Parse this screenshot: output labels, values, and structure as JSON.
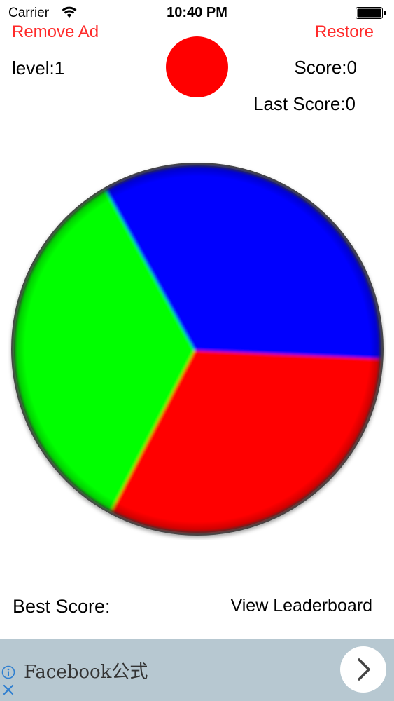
{
  "status_bar": {
    "carrier": "Carrier",
    "time": "10:40 PM",
    "wifi_icon": "wifi-icon",
    "battery_icon": "battery-icon"
  },
  "header": {
    "remove_ad": "Remove Ad",
    "restore": "Restore",
    "level": "level:1",
    "score": "Score:0",
    "last_score": "Last Score:0",
    "target_ball_color": "#ff0000"
  },
  "wheel": {
    "segments": [
      {
        "color_name": "blue",
        "color": "#0000ff"
      },
      {
        "color_name": "red",
        "color": "#ff0000"
      },
      {
        "color_name": "green",
        "color": "#00ff00"
      }
    ],
    "rim_color": "#333333"
  },
  "footer": {
    "best_score": "Best Score:",
    "view_leaderboard": "View Leaderboard"
  },
  "ad": {
    "text": "Facebook公式",
    "info_icon": "info-icon",
    "close_icon": "close-icon",
    "arrow_icon": "chevron-right-icon"
  }
}
